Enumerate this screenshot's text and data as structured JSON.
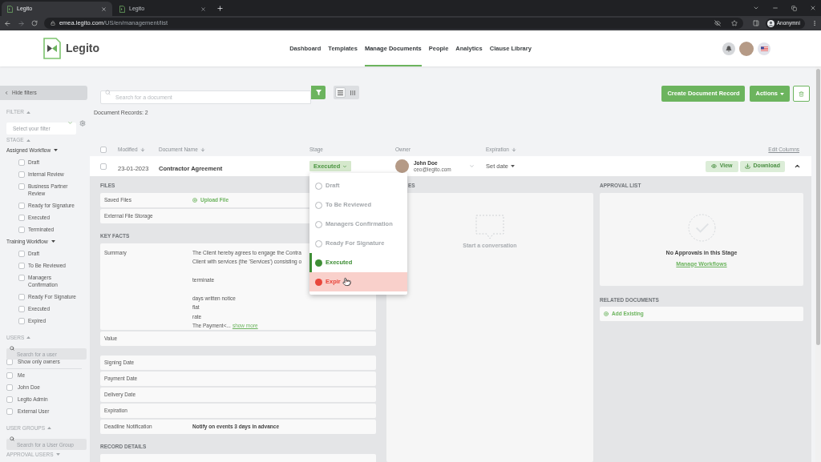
{
  "browser": {
    "tabs": [
      {
        "title": "Legito",
        "selected": true
      },
      {
        "title": "Legito",
        "selected": false
      }
    ],
    "url_host": "emea.legito.com",
    "url_path": "/US/en/management/list",
    "profile": "Anonymní"
  },
  "header": {
    "logo_text": "Legito",
    "nav": [
      {
        "label": "Dashboard",
        "selected": false
      },
      {
        "label": "Templates",
        "selected": false
      },
      {
        "label": "Manage Documents",
        "selected": true
      },
      {
        "label": "People",
        "selected": false
      },
      {
        "label": "Analytics",
        "selected": false
      },
      {
        "label": "Clause Library",
        "selected": false
      }
    ]
  },
  "sidebar": {
    "hide_button": "Hide filters",
    "sections": [
      {
        "kind": "select",
        "title": "FILTER",
        "expanded": true,
        "placeholder": "Select your filter"
      },
      {
        "kind": "workflows",
        "title": "STAGE",
        "expanded": true,
        "workflows": [
          {
            "name": "Assigned Workflow",
            "items": [
              {
                "label": "Draft",
                "checked": false
              },
              {
                "label": "Internal Review",
                "checked": false
              },
              {
                "label": "Business Partner Review",
                "checked": false
              },
              {
                "label": "Ready for Signature",
                "checked": false
              },
              {
                "label": "Executed",
                "checked": false
              },
              {
                "label": "Terminated",
                "checked": false
              }
            ]
          },
          {
            "name": "Training Workflow",
            "items": [
              {
                "label": "Draft",
                "checked": false
              },
              {
                "label": "To Be Reviewed",
                "checked": false
              },
              {
                "label": "Managers Confirmation",
                "checked": false
              },
              {
                "label": "Ready For Signature",
                "checked": false
              },
              {
                "label": "Executed",
                "checked": false
              },
              {
                "label": "Expired",
                "checked": false
              }
            ]
          }
        ]
      },
      {
        "kind": "users",
        "title": "USERS",
        "expanded": true,
        "placeholder": "Search for a user",
        "owners_only": {
          "label": "Show only owners",
          "checked": false
        },
        "users": [
          {
            "label": "Me",
            "checked": false
          },
          {
            "label": "John Doe",
            "checked": false
          },
          {
            "label": "Legito Admin",
            "checked": false
          },
          {
            "label": "External User",
            "checked": false
          }
        ]
      },
      {
        "kind": "search",
        "title": "USER GROUPS",
        "expanded": true,
        "placeholder": "Search for a User Group"
      },
      {
        "kind": "collapsed",
        "title": "APPROVAL USERS",
        "expanded": false
      }
    ]
  },
  "toolbar": {
    "search_placeholder": "Search for a document",
    "view_modes": [
      {
        "kind": "list",
        "selected": true
      },
      {
        "kind": "columns",
        "selected": false
      }
    ],
    "create_button": "Create Document Record",
    "actions_button": "Actions"
  },
  "records_count": "Document Records: 2",
  "table": {
    "select_all_checked": false,
    "columns": [
      {
        "label": "Modified",
        "sorted": true
      },
      {
        "label": "Document Name",
        "sorted": true
      },
      {
        "label": "Stage",
        "sorted": false
      },
      {
        "label": "Owner",
        "sorted": false
      },
      {
        "label": "Expiration",
        "sorted": true
      }
    ],
    "edit_columns": "Edit Columns",
    "rows": [
      {
        "checked": false,
        "modified": "23-01-2023",
        "name": "Contractor Agreement",
        "stage": "Executed",
        "owner_name": "John Doe",
        "owner_email": "ceo@legito.com",
        "expiration": "Set date",
        "view_button": "View",
        "download_button": "Download",
        "expanded": true
      }
    ]
  },
  "stage_menu": {
    "options": [
      {
        "label": "Draft",
        "selected": false,
        "hovered": false
      },
      {
        "label": "To Be Reviewed",
        "selected": false,
        "hovered": false
      },
      {
        "label": "Managers Confirmation",
        "selected": false,
        "hovered": false
      },
      {
        "label": "Ready For Signature",
        "selected": false,
        "hovered": false
      },
      {
        "label": "Executed",
        "selected": true,
        "hovered": false,
        "color": "#3e8e35"
      },
      {
        "label": "Expir",
        "selected": false,
        "hovered": true,
        "color": "#e8463b"
      }
    ]
  },
  "details": {
    "files": {
      "title": "FILES",
      "rows": [
        {
          "label": "Saved Files",
          "action": "Upload File"
        },
        {
          "label": "External File Storage"
        }
      ]
    },
    "key_facts": {
      "title": "KEY FACTS",
      "summary_label": "Summary",
      "summary_paragraphs": [
        [
          "The Client hereby agrees to engage the Contra",
          "Client with services (the 'Services') consisting o"
        ],
        [
          "terminate"
        ],
        [
          "days written notice",
          "flat",
          "rate",
          "The Payment<..."
        ]
      ],
      "show_more": "show more",
      "groups": [
        [
          {
            "label": "Value"
          }
        ],
        [
          {
            "label": "Signing Date"
          },
          {
            "label": "Payment Date"
          },
          {
            "label": "Delivery Date"
          },
          {
            "label": "Expiration"
          },
          {
            "label": "Deadline Notification",
            "value": "Notify on events 3 days in advance"
          }
        ]
      ]
    },
    "record_details": {
      "title": "RECORD DETAILS"
    },
    "conversation": {
      "heading": "ES",
      "empty_text": "Start a conversation"
    },
    "approval_list": {
      "title": "APPROVAL LIST",
      "empty_text": "No Approvals in this Stage",
      "link": "Manage Workflows"
    },
    "related_documents": {
      "title": "RELATED DOCUMENTS",
      "action": "Add Existing"
    }
  }
}
